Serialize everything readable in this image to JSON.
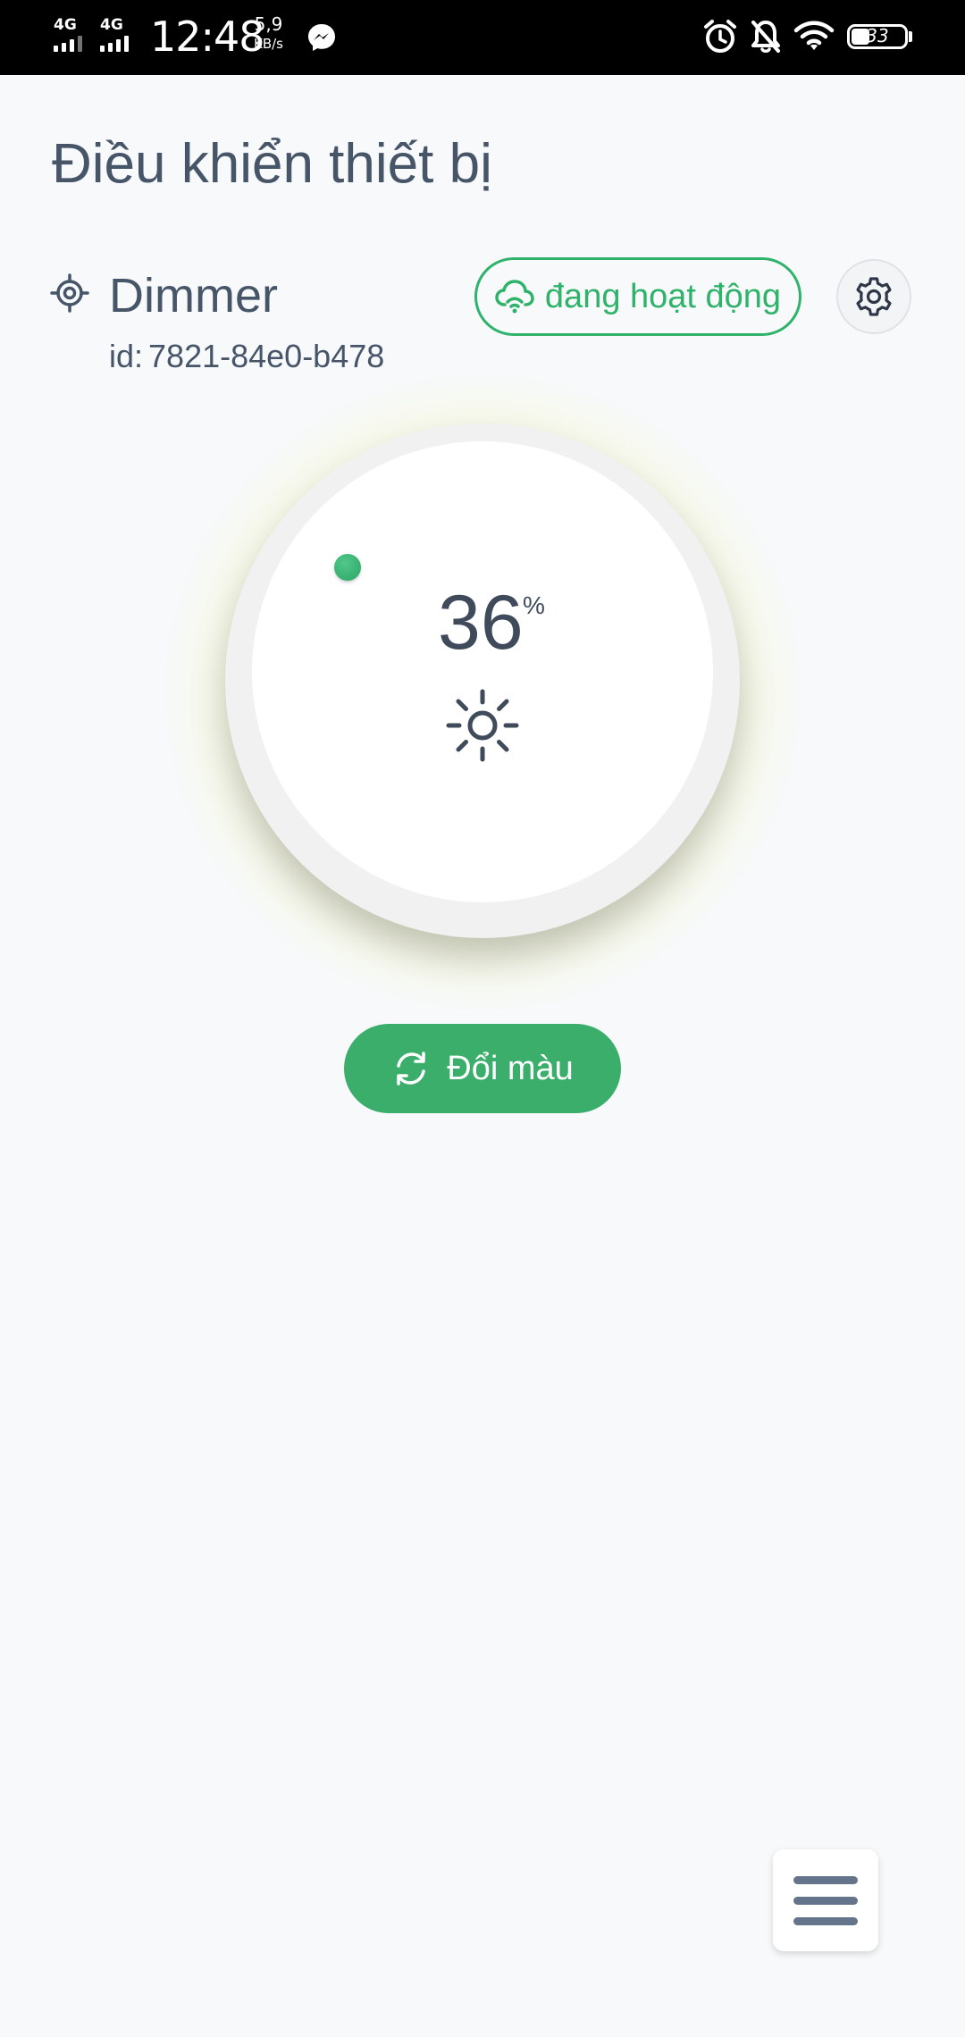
{
  "status_bar": {
    "network_1": "4G",
    "network_2": "4G",
    "time": "12:48",
    "speed_value": "5,9",
    "speed_unit": "KB/s",
    "battery": "33",
    "icons": [
      "messenger-icon",
      "alarm-icon",
      "bell-off-icon",
      "wifi-icon",
      "battery-icon"
    ]
  },
  "header": {
    "title": "Điều khiển thiết bị"
  },
  "device": {
    "icon": "target-icon",
    "name": "Dimmer",
    "id_label": "id:",
    "id_value": "7821-84e0-b478",
    "status_label": "đang hoạt động",
    "status_icon": "cloud-wifi-icon"
  },
  "dial": {
    "value": "36",
    "unit": "%",
    "level": 0.36,
    "icon": "sun-icon"
  },
  "actions": {
    "change_color_label": "Đổi màu",
    "change_color_icon": "refresh-icon"
  },
  "colors": {
    "accent": "#3aae6a",
    "status_green": "#2fb36a",
    "text": "#475569",
    "background": "#f7f9fb"
  }
}
